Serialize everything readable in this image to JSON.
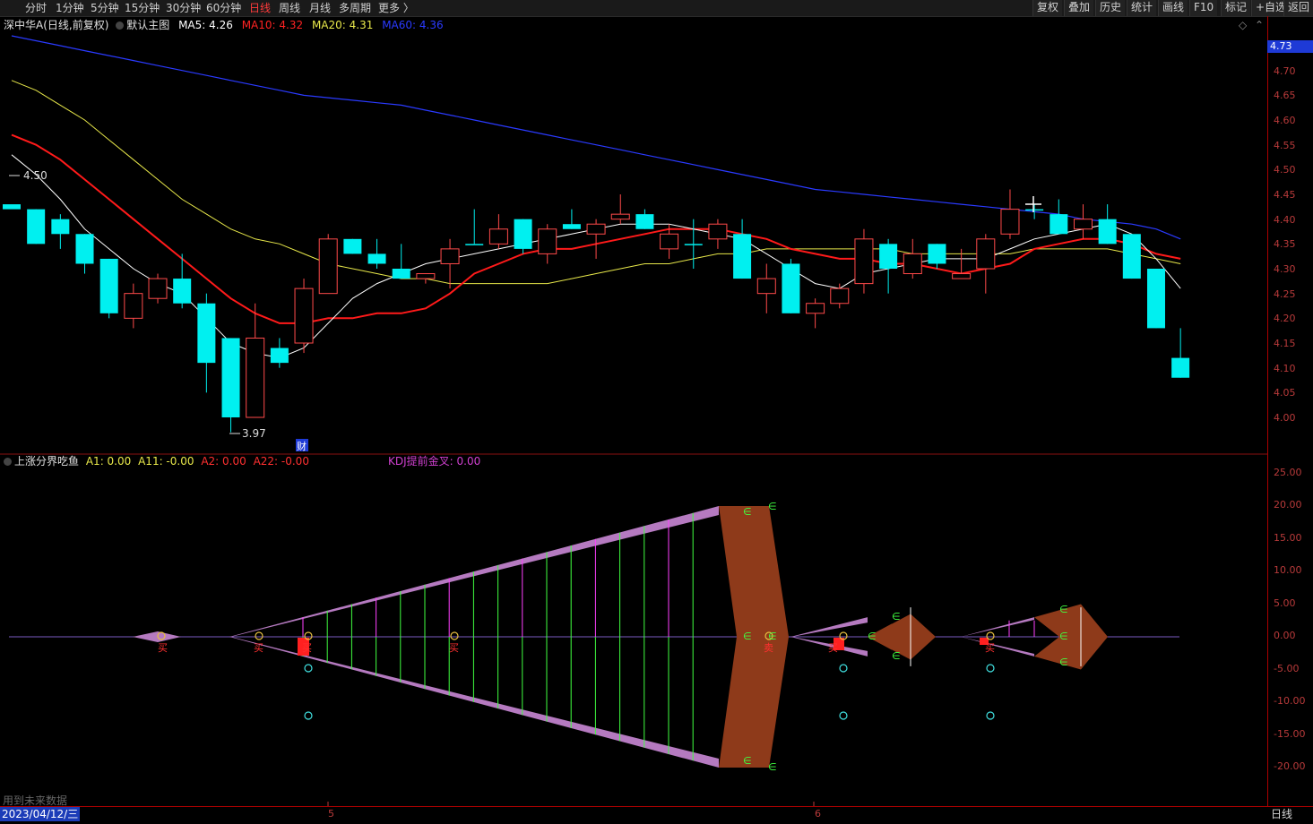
{
  "toolbar": {
    "periods": [
      "分时",
      "1分钟",
      "5分钟",
      "15分钟",
      "30分钟",
      "60分钟",
      "日线",
      "周线",
      "月线",
      "多周期",
      "更多 〉"
    ],
    "active_period": "日线",
    "right_buttons": [
      "复权",
      "叠加",
      "历史",
      "统计",
      "画线",
      "F10",
      "标记",
      "+自选",
      "返回"
    ]
  },
  "main_legend": {
    "stock": "深中华A",
    "mode": "(日线,前复权)",
    "chart_name": "默认主图",
    "ma5_label": "MA5: 4.26",
    "ma10_label": "MA10: 4.32",
    "ma20_label": "MA20: 4.31",
    "ma60_label": "MA60: 4.36"
  },
  "colors": {
    "up": "#ff4a4a",
    "down": "#00f0f0",
    "ma5": "#ffffff",
    "ma10": "#ff1a1a",
    "ma20": "#e8e84a",
    "ma60": "#2a3aff",
    "purple": "#b57ac0",
    "brown": "#8e3a1a",
    "axis": "#b83a3a"
  },
  "price_axis": {
    "current": "4.73",
    "ticks": [
      "4.70",
      "4.65",
      "4.60",
      "4.55",
      "4.50",
      "4.45",
      "4.40",
      "4.35",
      "4.30",
      "4.25",
      "4.20",
      "4.15",
      "4.10",
      "4.05",
      "4.00"
    ]
  },
  "annotations": {
    "high_label": "4.50",
    "low_label": "3.97",
    "cai_marker": "财"
  },
  "candles": [
    {
      "o": 4.43,
      "h": 4.43,
      "l": 4.43,
      "c": 4.42
    },
    {
      "o": 4.42,
      "h": 4.42,
      "l": 4.35,
      "c": 4.35
    },
    {
      "o": 4.4,
      "h": 4.41,
      "l": 4.34,
      "c": 4.37
    },
    {
      "o": 4.37,
      "h": 4.37,
      "l": 4.29,
      "c": 4.31
    },
    {
      "o": 4.32,
      "h": 4.32,
      "l": 4.2,
      "c": 4.21
    },
    {
      "o": 4.2,
      "h": 4.27,
      "l": 4.18,
      "c": 4.25
    },
    {
      "o": 4.24,
      "h": 4.29,
      "l": 4.23,
      "c": 4.28
    },
    {
      "o": 4.28,
      "h": 4.33,
      "l": 4.22,
      "c": 4.23
    },
    {
      "o": 4.23,
      "h": 4.25,
      "l": 4.05,
      "c": 4.11
    },
    {
      "o": 4.16,
      "h": 4.16,
      "l": 3.97,
      "c": 4.0
    },
    {
      "o": 4.0,
      "h": 4.23,
      "l": 4.0,
      "c": 4.16
    },
    {
      "o": 4.14,
      "h": 4.16,
      "l": 4.1,
      "c": 4.11
    },
    {
      "o": 4.15,
      "h": 4.28,
      "l": 4.13,
      "c": 4.26
    },
    {
      "o": 4.25,
      "h": 4.37,
      "l": 4.25,
      "c": 4.36
    },
    {
      "o": 4.36,
      "h": 4.36,
      "l": 4.33,
      "c": 4.33
    },
    {
      "o": 4.33,
      "h": 4.36,
      "l": 4.3,
      "c": 4.31
    },
    {
      "o": 4.3,
      "h": 4.35,
      "l": 4.28,
      "c": 4.28
    },
    {
      "o": 4.28,
      "h": 4.29,
      "l": 4.27,
      "c": 4.29
    },
    {
      "o": 4.31,
      "h": 4.36,
      "l": 4.26,
      "c": 4.34
    },
    {
      "o": 4.35,
      "h": 4.42,
      "l": 4.35,
      "c": 4.35
    },
    {
      "o": 4.35,
      "h": 4.41,
      "l": 4.34,
      "c": 4.38
    },
    {
      "o": 4.4,
      "h": 4.4,
      "l": 4.33,
      "c": 4.34
    },
    {
      "o": 4.33,
      "h": 4.39,
      "l": 4.31,
      "c": 4.38
    },
    {
      "o": 4.39,
      "h": 4.42,
      "l": 4.38,
      "c": 4.38
    },
    {
      "o": 4.37,
      "h": 4.4,
      "l": 4.32,
      "c": 4.39
    },
    {
      "o": 4.4,
      "h": 4.45,
      "l": 4.39,
      "c": 4.41
    },
    {
      "o": 4.41,
      "h": 4.42,
      "l": 4.38,
      "c": 4.38
    },
    {
      "o": 4.34,
      "h": 4.39,
      "l": 4.32,
      "c": 4.37
    },
    {
      "o": 4.35,
      "h": 4.4,
      "l": 4.3,
      "c": 4.35
    },
    {
      "o": 4.36,
      "h": 4.4,
      "l": 4.34,
      "c": 4.39
    },
    {
      "o": 4.37,
      "h": 4.4,
      "l": 4.28,
      "c": 4.28
    },
    {
      "o": 4.25,
      "h": 4.31,
      "l": 4.21,
      "c": 4.28
    },
    {
      "o": 4.31,
      "h": 4.32,
      "l": 4.21,
      "c": 4.21
    },
    {
      "o": 4.21,
      "h": 4.24,
      "l": 4.18,
      "c": 4.23
    },
    {
      "o": 4.23,
      "h": 4.27,
      "l": 4.22,
      "c": 4.26
    },
    {
      "o": 4.27,
      "h": 4.38,
      "l": 4.25,
      "c": 4.36
    },
    {
      "o": 4.35,
      "h": 4.36,
      "l": 4.25,
      "c": 4.3
    },
    {
      "o": 4.29,
      "h": 4.36,
      "l": 4.28,
      "c": 4.33
    },
    {
      "o": 4.35,
      "h": 4.35,
      "l": 4.3,
      "c": 4.31
    },
    {
      "o": 4.28,
      "h": 4.34,
      "l": 4.28,
      "c": 4.29
    },
    {
      "o": 4.3,
      "h": 4.37,
      "l": 4.25,
      "c": 4.36
    },
    {
      "o": 4.37,
      "h": 4.46,
      "l": 4.36,
      "c": 4.42
    },
    {
      "o": 4.42,
      "h": 4.43,
      "l": 4.4,
      "c": 4.42
    },
    {
      "o": 4.41,
      "h": 4.44,
      "l": 4.37,
      "c": 4.37
    },
    {
      "o": 4.38,
      "h": 4.43,
      "l": 4.36,
      "c": 4.4
    },
    {
      "o": 4.4,
      "h": 4.43,
      "l": 4.35,
      "c": 4.35
    },
    {
      "o": 4.37,
      "h": 4.37,
      "l": 4.28,
      "c": 4.28
    },
    {
      "o": 4.3,
      "h": 4.3,
      "l": 4.18,
      "c": 4.18
    },
    {
      "o": 4.12,
      "h": 4.18,
      "l": 4.08,
      "c": 4.08
    }
  ],
  "ma5": [
    4.53,
    4.49,
    4.44,
    4.38,
    4.34,
    4.3,
    4.27,
    4.25,
    4.2,
    4.15,
    4.13,
    4.12,
    4.14,
    4.19,
    4.24,
    4.27,
    4.29,
    4.31,
    4.32,
    4.33,
    4.34,
    4.35,
    4.36,
    4.37,
    4.38,
    4.39,
    4.39,
    4.39,
    4.38,
    4.37,
    4.36,
    4.33,
    4.3,
    4.27,
    4.26,
    4.29,
    4.3,
    4.31,
    4.32,
    4.32,
    4.32,
    4.34,
    4.36,
    4.37,
    4.38,
    4.39,
    4.37,
    4.32,
    4.26
  ],
  "ma10": [
    4.57,
    4.55,
    4.52,
    4.48,
    4.44,
    4.4,
    4.36,
    4.32,
    4.28,
    4.24,
    4.21,
    4.19,
    4.19,
    4.2,
    4.2,
    4.21,
    4.21,
    4.22,
    4.25,
    4.29,
    4.31,
    4.33,
    4.34,
    4.34,
    4.35,
    4.36,
    4.37,
    4.38,
    4.38,
    4.38,
    4.37,
    4.36,
    4.34,
    4.33,
    4.32,
    4.32,
    4.31,
    4.31,
    4.3,
    4.29,
    4.3,
    4.31,
    4.34,
    4.35,
    4.36,
    4.36,
    4.35,
    4.33,
    4.32
  ],
  "ma20": [
    4.68,
    4.66,
    4.63,
    4.6,
    4.56,
    4.52,
    4.48,
    4.44,
    4.41,
    4.38,
    4.36,
    4.35,
    4.33,
    4.31,
    4.3,
    4.29,
    4.28,
    4.28,
    4.27,
    4.27,
    4.27,
    4.27,
    4.27,
    4.28,
    4.29,
    4.3,
    4.31,
    4.31,
    4.32,
    4.33,
    4.33,
    4.34,
    4.34,
    4.34,
    4.34,
    4.34,
    4.34,
    4.33,
    4.33,
    4.33,
    4.33,
    4.33,
    4.34,
    4.34,
    4.34,
    4.34,
    4.33,
    4.32,
    4.31
  ],
  "ma60": [
    4.77,
    4.76,
    4.75,
    4.74,
    4.73,
    4.72,
    4.71,
    4.7,
    4.69,
    4.68,
    4.67,
    4.66,
    4.65,
    4.645,
    4.64,
    4.635,
    4.63,
    4.62,
    4.61,
    4.6,
    4.59,
    4.58,
    4.57,
    4.56,
    4.55,
    4.54,
    4.53,
    4.52,
    4.51,
    4.5,
    4.49,
    4.48,
    4.47,
    4.46,
    4.455,
    4.45,
    4.445,
    4.44,
    4.435,
    4.43,
    4.425,
    4.42,
    4.415,
    4.41,
    4.4,
    4.395,
    4.39,
    4.38,
    4.36
  ],
  "indicator_legend": {
    "name": "上涨分界吃鱼",
    "a1": "A1: 0.00",
    "a11": "A11: -0.00",
    "a2": "A2: 0.00",
    "a22": "A22: -0.00",
    "kdj": "KDJ提前金叉: 0.00"
  },
  "indicator_axis": {
    "ticks": [
      "25.00",
      "20.00",
      "15.00",
      "10.00",
      "5.00",
      "0.00",
      "-5.00",
      "-10.00",
      "-15.00",
      "-20.00"
    ]
  },
  "indicator_labels": {
    "buy": "买",
    "sell": "卖",
    "e_glyph": "∈"
  },
  "bottom": {
    "date": "2023/04/12/三",
    "month5": "5",
    "month6": "6",
    "period": "日线",
    "future_note": "用到未来数据"
  }
}
